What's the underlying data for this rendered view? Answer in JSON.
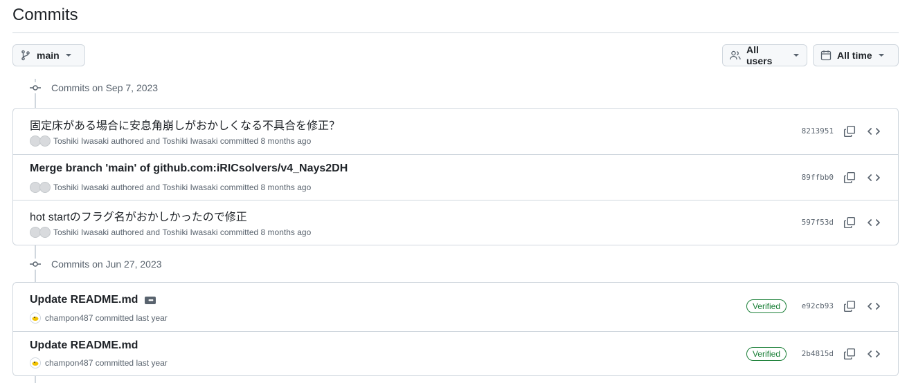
{
  "page": {
    "title": "Commits"
  },
  "toolbar": {
    "branch": {
      "label": "main",
      "icon": "git-branch-icon"
    },
    "users": {
      "label": "All users",
      "icon": "people-icon"
    },
    "time": {
      "label": "All time",
      "icon": "calendar-icon"
    }
  },
  "groups": [
    {
      "header": "Commits on Sep 7, 2023",
      "commits": [
        {
          "title": "固定床がある場合に安息角崩しがおかしくなる不具合を修正？",
          "author": "Toshiki Iwasaki",
          "authored_text": "authored and",
          "committer": "Toshiki Iwasaki",
          "committed_text": "committed",
          "time": "8 months ago",
          "sha": "8213951"
        },
        {
          "title": "Merge branch 'main' of github.com:iRICsolvers/v4_Nays2DH",
          "author": "Toshiki Iwasaki",
          "authored_text": "authored and",
          "committer": "Toshiki Iwasaki",
          "committed_text": "committed",
          "time": "8 months ago",
          "sha": "89ffbb0"
        },
        {
          "title": "hot startのフラグ名がおかしかったので修正",
          "author": "Toshiki Iwasaki",
          "authored_text": "authored and",
          "committer": "Toshiki Iwasaki",
          "committed_text": "committed",
          "time": "8 months ago",
          "sha": "597f53d"
        }
      ]
    },
    {
      "header": "Commits on Jun 27, 2023",
      "commits": [
        {
          "title": "Update README.md",
          "committer": "champon487",
          "committed_text": "committed",
          "time": "last year",
          "badge": "Verified",
          "sha": "e92cb93"
        },
        {
          "title": "Update README.md",
          "committer": "champon487",
          "committed_text": "committed",
          "time": "last year",
          "badge": "Verified",
          "sha": "2b4815d"
        }
      ]
    }
  ],
  "colors": {
    "border": "#d0d7de",
    "muted": "#59636e",
    "verified": "#1a7f37",
    "text": "#1f2328"
  }
}
